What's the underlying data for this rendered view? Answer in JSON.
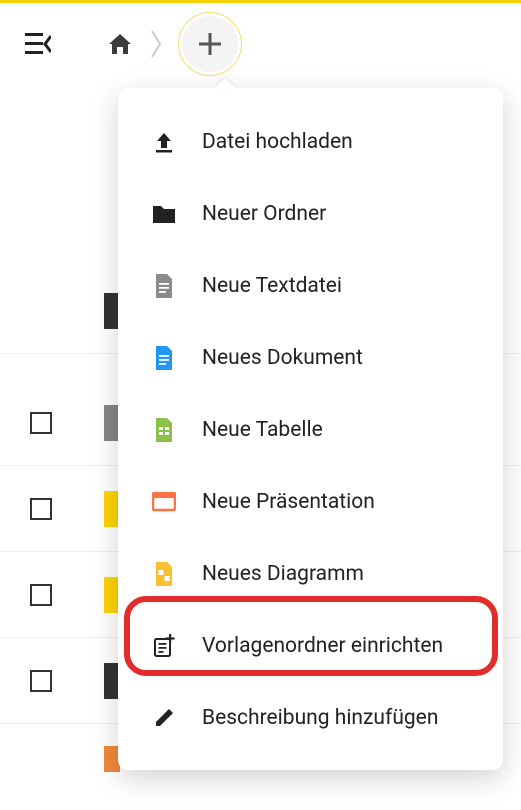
{
  "dropdown": {
    "items": [
      {
        "label": "Datei hochladen"
      },
      {
        "label": "Neuer Ordner"
      },
      {
        "label": "Neue Textdatei"
      },
      {
        "label": "Neues Dokument"
      },
      {
        "label": "Neue Tabelle"
      },
      {
        "label": "Neue Präsentation"
      },
      {
        "label": "Neues Diagramm"
      },
      {
        "label": "Vorlagenordner einrichten"
      },
      {
        "label": "Beschreibung hinzufügen"
      }
    ]
  },
  "colors": {
    "accent_yellow": "#ffd400",
    "highlight_red": "#e22b2b",
    "doc_blue": "#2196f3",
    "sheet_green": "#8bc34a",
    "pres_orange": "#ff7043",
    "diagram_amber": "#fbc02d"
  }
}
